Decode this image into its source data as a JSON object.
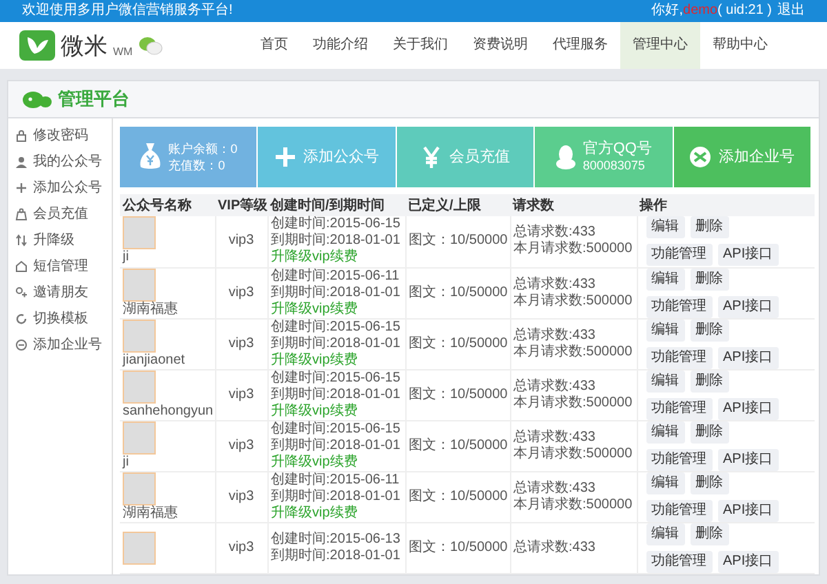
{
  "top_bar": {
    "welcome": "欢迎使用多用户微信营销服务平台!",
    "greeting": "你好,",
    "username": "demo",
    "uid": "( uid:21 )",
    "logout": "退出"
  },
  "logo": {
    "name": "微米",
    "sub": "WM"
  },
  "nav": [
    {
      "label": "首页",
      "selected": false
    },
    {
      "label": "功能介绍",
      "selected": false
    },
    {
      "label": "关于我们",
      "selected": false
    },
    {
      "label": "资费说明",
      "selected": false
    },
    {
      "label": "代理服务",
      "selected": false
    },
    {
      "label": "管理中心",
      "selected": true
    },
    {
      "label": "帮助中心",
      "selected": false
    }
  ],
  "panel_title": "管理平台",
  "sidebar": {
    "items": [
      "修改密码",
      "我的公众号",
      "添加公众号",
      "会员充值",
      "升降级",
      "短信管理",
      "邀请朋友",
      "切换模板",
      "添加企业号"
    ]
  },
  "tiles": [
    {
      "kind": "balance",
      "lines": [
        "账户余额：0",
        "充值数：0"
      ],
      "color": "#71b2e0"
    },
    {
      "kind": "action",
      "label": "添加公众号",
      "color": "#62c3dd"
    },
    {
      "kind": "action",
      "label": "会员充值",
      "color": "#5ecbbb"
    },
    {
      "kind": "qq",
      "label": "官方QQ号",
      "number": "800083075",
      "color": "#5bcd8e"
    },
    {
      "kind": "action",
      "label": "添加企业号",
      "color": "#4dbf5e"
    }
  ],
  "table": {
    "columns": [
      "公众号名称",
      "VIP等级",
      "创建时间/到期时间",
      "已定义/上限",
      "请求数",
      "操作"
    ],
    "rows": [
      {
        "name": "ji",
        "vip": "vip3",
        "created": "创建时间:2015-06-15",
        "expires": "到期时间:2018-01-01",
        "upgrade": "升降级vip续费",
        "defined": "图文：10/50000",
        "total": "总请求数:433",
        "monthly": "本月请求数:500000",
        "actions": [
          "编辑",
          "删除",
          "功能管理",
          "API接口"
        ]
      },
      {
        "name": "湖南福惠",
        "vip": "vip3",
        "created": "创建时间:2015-06-11",
        "expires": "到期时间:2018-01-01",
        "upgrade": "升降级vip续费",
        "defined": "图文：10/50000",
        "total": "总请求数:433",
        "monthly": "本月请求数:500000",
        "actions": [
          "编辑",
          "删除",
          "功能管理",
          "API接口"
        ]
      },
      {
        "name": "jianjiaonet",
        "vip": "vip3",
        "created": "创建时间:2015-06-15",
        "expires": "到期时间:2018-01-01",
        "upgrade": "升降级vip续费",
        "defined": "图文：10/50000",
        "total": "总请求数:433",
        "monthly": "本月请求数:500000",
        "actions": [
          "编辑",
          "删除",
          "功能管理",
          "API接口"
        ]
      },
      {
        "name": "sanhehongyun",
        "vip": "vip3",
        "created": "创建时间:2015-06-15",
        "expires": "到期时间:2018-01-01",
        "upgrade": "升降级vip续费",
        "defined": "图文：10/50000",
        "total": "总请求数:433",
        "monthly": "本月请求数:500000",
        "actions": [
          "编辑",
          "删除",
          "功能管理",
          "API接口"
        ]
      },
      {
        "name": "ji",
        "vip": "vip3",
        "created": "创建时间:2015-06-15",
        "expires": "到期时间:2018-01-01",
        "upgrade": "升降级vip续费",
        "defined": "图文：10/50000",
        "total": "总请求数:433",
        "monthly": "本月请求数:500000",
        "actions": [
          "编辑",
          "删除",
          "功能管理",
          "API接口"
        ]
      },
      {
        "name": "湖南福惠",
        "vip": "vip3",
        "created": "创建时间:2015-06-11",
        "expires": "到期时间:2018-01-01",
        "upgrade": "升降级vip续费",
        "defined": "图文：10/50000",
        "total": "总请求数:433",
        "monthly": "本月请求数:500000",
        "actions": [
          "编辑",
          "删除",
          "功能管理",
          "API接口"
        ]
      },
      {
        "vip": "vip3",
        "created": "创建时间:2015-06-13",
        "expires": "到期时间:2018-01-01",
        "defined": "图文：10/50000",
        "total": "总请求数:433",
        "actions": [
          "编辑",
          "删除",
          "功能管理",
          "API接口"
        ]
      }
    ]
  }
}
